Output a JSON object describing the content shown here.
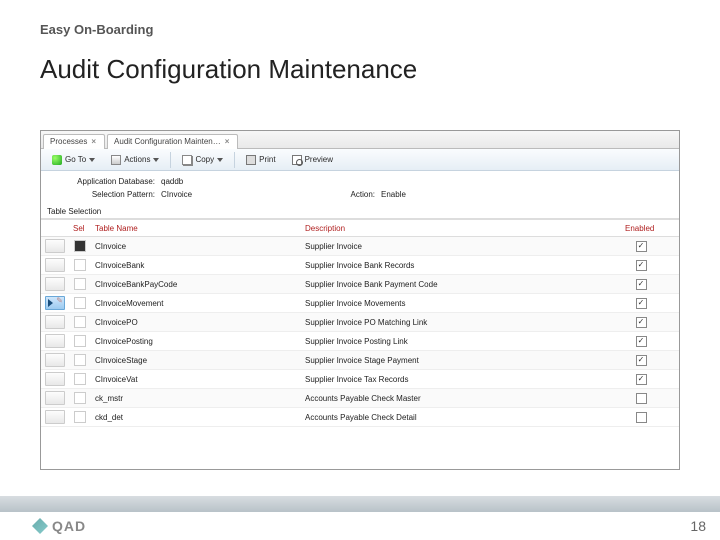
{
  "slide": {
    "eyebrow": "Easy On-Boarding",
    "title": "Audit Configuration Maintenance",
    "page_number": "18",
    "logo_text": "QAD"
  },
  "tabs": [
    {
      "label": "Processes"
    },
    {
      "label": "Audit Configuration Mainten…"
    }
  ],
  "toolbar": {
    "goto": "Go To",
    "actions": "Actions",
    "copy": "Copy",
    "print": "Print",
    "preview": "Preview"
  },
  "form": {
    "db_label": "Application Database:",
    "db_value": "qaddb",
    "pattern_label": "Selection Pattern:",
    "pattern_value": "CInvoice",
    "action_label": "Action:",
    "action_value": "Enable"
  },
  "section": {
    "title": "Table Selection"
  },
  "columns": {
    "sel": "Sel",
    "name": "Table Name",
    "desc": "Description",
    "enabled": "Enabled"
  },
  "rows": [
    {
      "sel": true,
      "name": "CInvoice",
      "desc": "Supplier Invoice",
      "enabled": true,
      "active": false
    },
    {
      "sel": false,
      "name": "CInvoiceBank",
      "desc": "Supplier Invoice Bank Records",
      "enabled": true,
      "active": false
    },
    {
      "sel": false,
      "name": "CInvoiceBankPayCode",
      "desc": "Supplier Invoice Bank Payment Code",
      "enabled": true,
      "active": false
    },
    {
      "sel": false,
      "name": "CInvoiceMovement",
      "desc": "Supplier Invoice Movements",
      "enabled": true,
      "active": true
    },
    {
      "sel": false,
      "name": "CInvoicePO",
      "desc": "Supplier Invoice PO Matching Link",
      "enabled": true,
      "active": false
    },
    {
      "sel": false,
      "name": "CInvoicePosting",
      "desc": "Supplier Invoice Posting Link",
      "enabled": true,
      "active": false
    },
    {
      "sel": false,
      "name": "CInvoiceStage",
      "desc": "Supplier Invoice Stage Payment",
      "enabled": true,
      "active": false
    },
    {
      "sel": false,
      "name": "CInvoiceVat",
      "desc": "Supplier Invoice Tax Records",
      "enabled": true,
      "active": false
    },
    {
      "sel": false,
      "name": "ck_mstr",
      "desc": "Accounts Payable Check Master",
      "enabled": false,
      "active": false
    },
    {
      "sel": false,
      "name": "ckd_det",
      "desc": "Accounts Payable Check Detail",
      "enabled": false,
      "active": false
    }
  ]
}
